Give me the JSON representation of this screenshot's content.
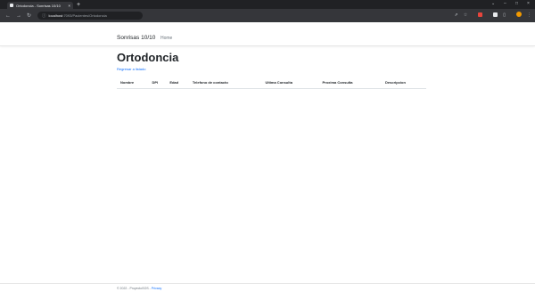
{
  "browser": {
    "tab_title": "Ortodoncia - Sonrisas 10/10",
    "tab_close": "×",
    "new_tab": "+",
    "url_host": "localhost",
    "url_path": ":7093/Pacientes/Ortodoncia",
    "controls": {
      "minimize": "–",
      "maximize": "□",
      "close": "×",
      "chevron": "⌄"
    }
  },
  "navbar": {
    "brand": "Sonrisas 10/10",
    "home": "Home"
  },
  "main": {
    "title": "Ortodoncia",
    "back_link": "Regresar a listado",
    "table": {
      "headers": [
        "Nombre",
        "DPI",
        "Edad",
        "Telefono de contacto",
        "Ultima Consulta",
        "Proxima Consulta",
        "Descripcion"
      ],
      "rows": []
    }
  },
  "footer": {
    "text": "© 2022 - ProyectoSOS -",
    "privacy": "Privacy"
  },
  "colors": {
    "link": "#0d6efd",
    "tab_bar": "#202124",
    "toolbar": "#35363a"
  }
}
